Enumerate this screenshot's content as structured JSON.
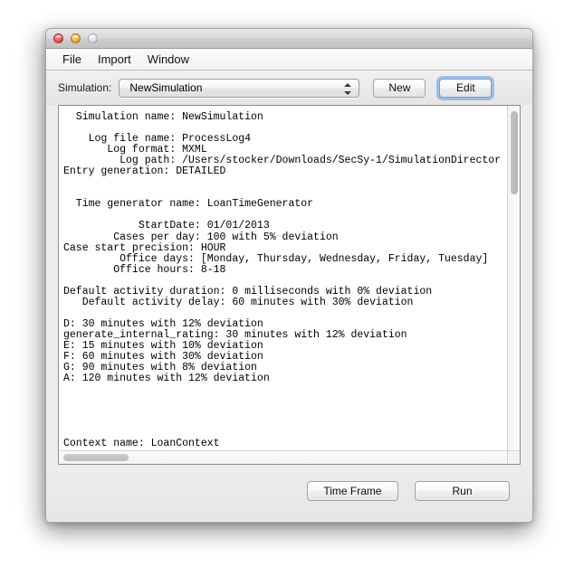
{
  "window": {
    "traffic_lights": {
      "close": "close-button",
      "minimize": "minimize-button",
      "zoom": "zoom-button"
    }
  },
  "menubar": {
    "items": [
      {
        "label": "File"
      },
      {
        "label": "Import"
      },
      {
        "label": "Window"
      }
    ]
  },
  "toolbar": {
    "simulation_label": "Simulation:",
    "simulation_value": "NewSimulation",
    "new_label": "New",
    "edit_label": "Edit"
  },
  "textpane": {
    "lines": [
      "  Simulation name: NewSimulation",
      "",
      "    Log file name: ProcessLog4",
      "       Log format: MXML",
      "         Log path: /Users/stocker/Downloads/SecSy-1/SimulationDirector",
      "Entry generation: DETAILED",
      "",
      "",
      "  Time generator name: LoanTimeGenerator",
      "",
      "            StartDate: 01/01/2013",
      "        Cases per day: 100 with 5% deviation",
      "Case start precision: HOUR",
      "         Office days: [Monday, Thursday, Wednesday, Friday, Tuesday]",
      "        Office hours: 8-18",
      "",
      "Default activity duration: 0 milliseconds with 0% deviation",
      "   Default activity delay: 60 minutes with 30% deviation",
      "",
      "D: 30 minutes with 12% deviation",
      "generate_internal_rating: 30 minutes with 12% deviation",
      "E: 15 minutes with 10% deviation",
      "F: 60 minutes with 30% deviation",
      "G: 90 minutes with 8% deviation",
      "A: 120 minutes with 12% deviation",
      "",
      "",
      "",
      "",
      "",
      "Context name: LoanContext"
    ]
  },
  "footer": {
    "time_frame_label": "Time Frame",
    "run_label": "Run"
  },
  "colors": {
    "focus_ring": "#5c96e1",
    "close": "#ec6257",
    "minimize": "#f6bc3e",
    "zoom": "#e3e3e3",
    "window_chrome": "#ececec",
    "text": "#000000"
  }
}
